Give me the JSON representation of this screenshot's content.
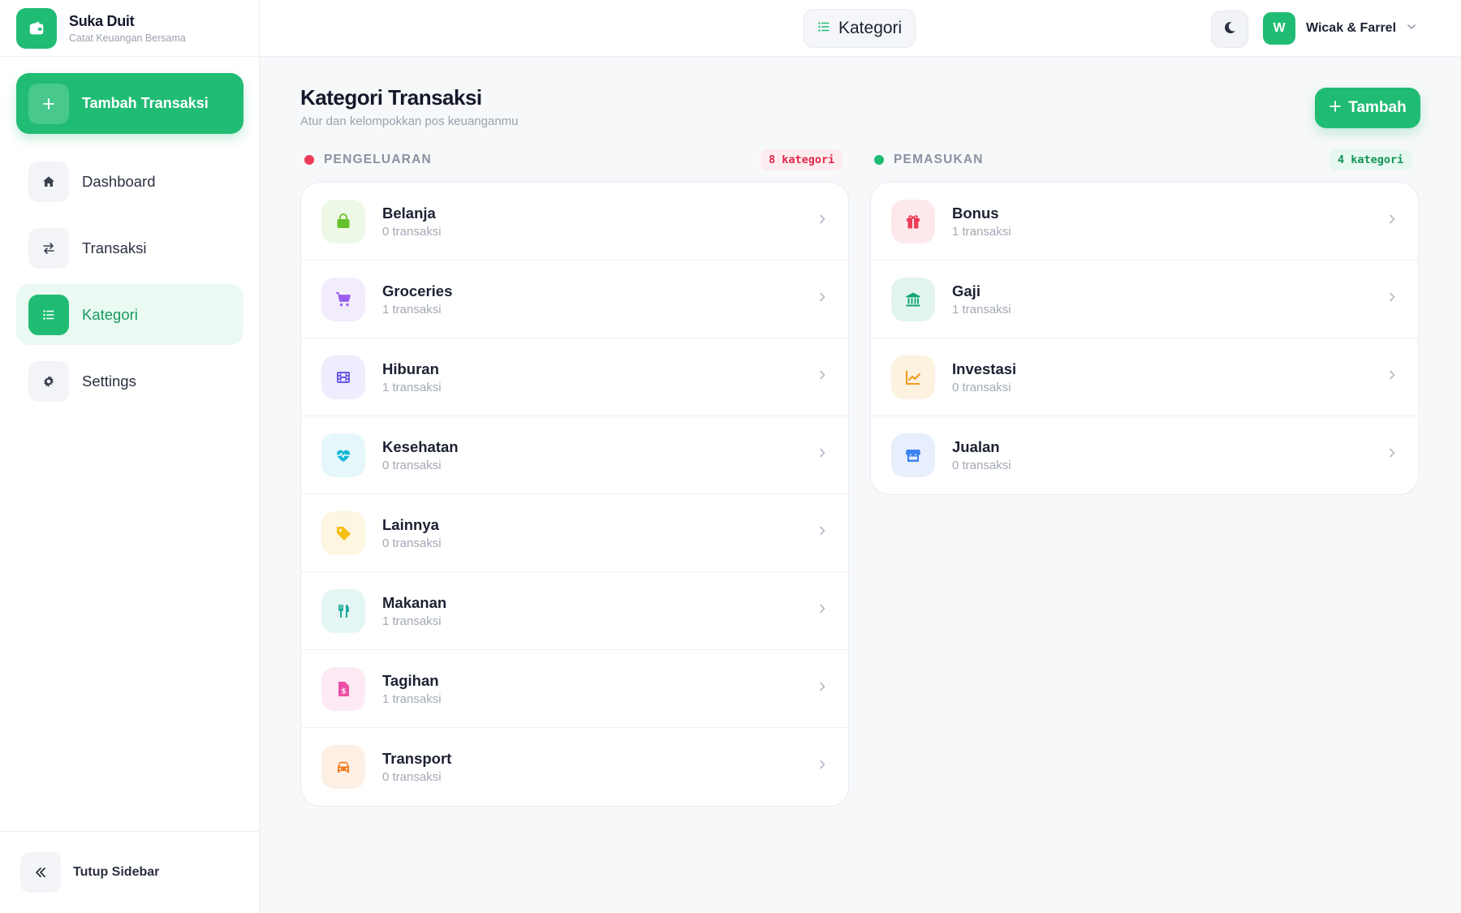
{
  "brand": {
    "name": "Suka Duit",
    "tagline": "Catat Keuangan Bersama",
    "icon": "wallet-icon"
  },
  "sidebar": {
    "add_button": "Tambah Transaksi",
    "items": [
      {
        "label": "Dashboard",
        "icon": "home-icon"
      },
      {
        "label": "Transaksi",
        "icon": "swap-icon"
      },
      {
        "label": "Kategori",
        "icon": "list-icon",
        "active": true
      },
      {
        "label": "Settings",
        "icon": "gear-icon"
      }
    ],
    "collapse_label": "Tutup Sidebar"
  },
  "topbar": {
    "page_label": "Kategori",
    "user": {
      "initial": "W",
      "name": "Wicak & Farrel"
    }
  },
  "main": {
    "title": "Kategori Transaksi",
    "subtitle": "Atur dan kelompokkan pos keuanganmu",
    "add_button": "Tambah",
    "expense": {
      "label": "PENGELUARAN",
      "count": "8 kategori",
      "color": "#ef3b5a",
      "categories": [
        {
          "name": "Belanja",
          "count": "0 transaksi",
          "icon": "shopping-bag-icon",
          "color": "#65c22b",
          "bg": "#eef8e6"
        },
        {
          "name": "Groceries",
          "count": "1 transaksi",
          "icon": "cart-icon",
          "color": "#9a5cf0",
          "bg": "#f2ecfd"
        },
        {
          "name": "Hiburan",
          "count": "1 transaksi",
          "icon": "film-icon",
          "color": "#6a5be8",
          "bg": "#eeedfd"
        },
        {
          "name": "Kesehatan",
          "count": "0 transaksi",
          "icon": "heartbeat-icon",
          "color": "#16b6d6",
          "bg": "#e5f7fb"
        },
        {
          "name": "Lainnya",
          "count": "0 transaksi",
          "icon": "tag-icon",
          "color": "#f5bf14",
          "bg": "#fdf6e0"
        },
        {
          "name": "Makanan",
          "count": "1 transaksi",
          "icon": "utensils-icon",
          "color": "#19a99a",
          "bg": "#e4f6f3"
        },
        {
          "name": "Tagihan",
          "count": "1 transaksi",
          "icon": "invoice-icon",
          "color": "#ec4fa6",
          "bg": "#fdeaf4"
        },
        {
          "name": "Transport",
          "count": "0 transaksi",
          "icon": "car-icon",
          "color": "#f27a1f",
          "bg": "#fdefe4"
        }
      ]
    },
    "income": {
      "label": "PEMASUKAN",
      "count": "4 kategori",
      "color": "#21bc74",
      "categories": [
        {
          "name": "Bonus",
          "count": "1 transaksi",
          "icon": "gift-icon",
          "color": "#ee3d57",
          "bg": "#fde9ec"
        },
        {
          "name": "Gaji",
          "count": "1 transaksi",
          "icon": "bank-icon",
          "color": "#16a572",
          "bg": "#e3f6ee"
        },
        {
          "name": "Investasi",
          "count": "0 transaksi",
          "icon": "chart-line-icon",
          "color": "#f2991b",
          "bg": "#fdf1e0"
        },
        {
          "name": "Jualan",
          "count": "0 transaksi",
          "icon": "store-icon",
          "color": "#3b82f0",
          "bg": "#e7effd"
        }
      ]
    }
  }
}
